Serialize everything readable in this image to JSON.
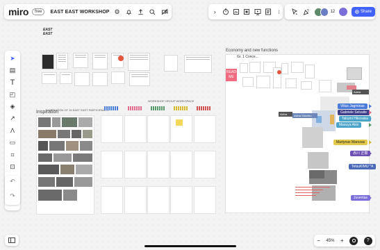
{
  "app": {
    "logo": "miro",
    "plan_badge": "free",
    "board_name": "EAST EAST WORKSHOP"
  },
  "topbar": {
    "left_icons": [
      "settings-icon",
      "bell-icon",
      "upload-icon",
      "search-icon",
      "no-video-icon"
    ],
    "tools_expand": "›",
    "tools_icons": [
      "timer-icon",
      "card-icon",
      "frame-icon",
      "present-icon",
      "document-icon",
      "more-icon"
    ],
    "collab": {
      "participant_count": "12",
      "share_label": "Share"
    }
  },
  "left_toolbar": {
    "tools": [
      {
        "name": "select-tool",
        "glyph": "➤"
      },
      {
        "name": "template-tool",
        "glyph": "▤"
      },
      {
        "name": "text-tool",
        "glyph": "T"
      },
      {
        "name": "sticky-note-tool",
        "glyph": "◰"
      },
      {
        "name": "shapes-tool",
        "glyph": "◈"
      },
      {
        "name": "connector-tool",
        "glyph": "↗"
      },
      {
        "name": "pen-tool",
        "glyph": "Λ"
      },
      {
        "name": "comment-tool",
        "glyph": "▭"
      },
      {
        "name": "frame-tool",
        "glyph": "⌗"
      },
      {
        "name": "upload-tool",
        "glyph": "⊡"
      },
      {
        "name": "more-tools",
        "glyph": "»"
      }
    ],
    "undo": "↶",
    "redo": "↷"
  },
  "bottom": {
    "zoom_out": "−",
    "zoom_level": "45%",
    "zoom_in": "+",
    "help": "?"
  },
  "board": {
    "logo_text_line1": "EAST",
    "logo_text_line2": "EAST",
    "inspiration_title": "Inspiration",
    "inspiration_header": "INSPIRATION OF 15 EAST EAST PARTICIPANTS",
    "workshop_header": "WORKSHOP GROUP WORKSPACE",
    "economy_title": "Economy and new functions",
    "gr_label": "Gr. 1 Conce...",
    "read_me": "READ ME",
    "akiha_label": "Akiha",
    "akiha_label2": "Akiha Shichiro",
    "adela_label": "Adela"
  },
  "name_tags": [
    {
      "label": "Vilius Jagminas",
      "color": "#4b7bd8"
    },
    {
      "label": "Gabriele Selvaite",
      "color": "#3e3e8a"
    },
    {
      "label": "Takumi Hikosaka",
      "color": "#4aa3c9"
    },
    {
      "label": "Masuya Akio",
      "color": "#4aa3c9"
    },
    {
      "label": "Martynas Marozas",
      "color": "#e2c94a"
    },
    {
      "label": "赤川 正樹",
      "color": "#6d4fb3"
    },
    {
      "label": "TetsuKIMURA",
      "color": "#4a6ab8"
    },
    {
      "label": "Juventas",
      "color": "#7a6ed8"
    }
  ],
  "colors": {
    "accent": "#4262ff",
    "avatar1": "#5d8a6a",
    "avatar2": "#6b7dc3",
    "avatar3": "#a0a0a0"
  }
}
